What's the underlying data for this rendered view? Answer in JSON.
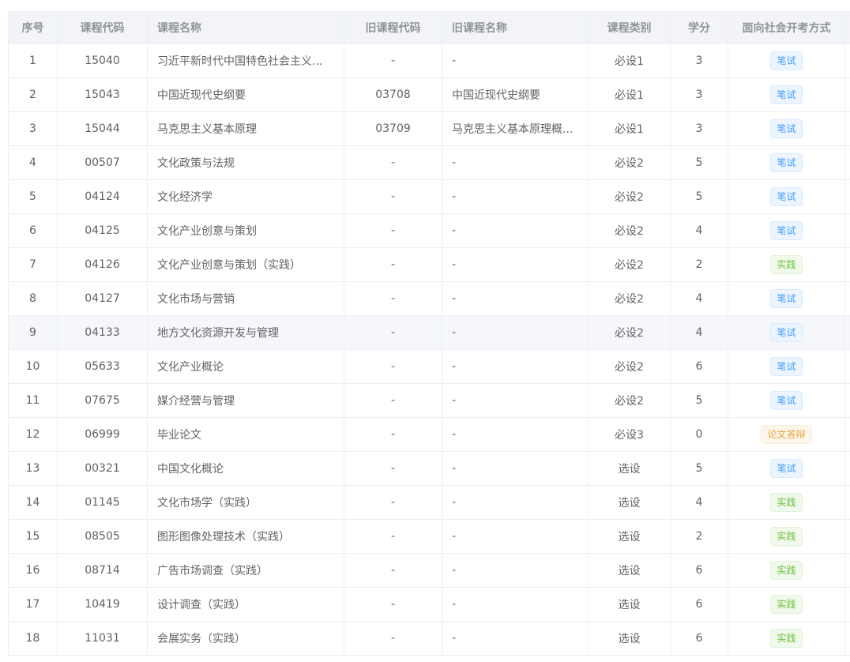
{
  "table": {
    "headers": [
      "序号",
      "课程代码",
      "课程名称",
      "旧课程代码",
      "旧课程名称",
      "课程类别",
      "学分",
      "面向社会开考方式"
    ],
    "rows": [
      {
        "no": "1",
        "code": "15040",
        "name": "习近平新时代中国特色社会主义...",
        "old_code": "-",
        "old_name": "-",
        "category": "必设1",
        "credits": "3",
        "exam": "笔试",
        "exam_type": "written"
      },
      {
        "no": "2",
        "code": "15043",
        "name": "中国近现代史纲要",
        "old_code": "03708",
        "old_name": "中国近现代史纲要",
        "category": "必设1",
        "credits": "3",
        "exam": "笔试",
        "exam_type": "written"
      },
      {
        "no": "3",
        "code": "15044",
        "name": "马克思主义基本原理",
        "old_code": "03709",
        "old_name": "马克思主义基本原理概...",
        "category": "必设1",
        "credits": "3",
        "exam": "笔试",
        "exam_type": "written"
      },
      {
        "no": "4",
        "code": "00507",
        "name": "文化政策与法规",
        "old_code": "-",
        "old_name": "-",
        "category": "必设2",
        "credits": "5",
        "exam": "笔试",
        "exam_type": "written"
      },
      {
        "no": "5",
        "code": "04124",
        "name": "文化经济学",
        "old_code": "-",
        "old_name": "-",
        "category": "必设2",
        "credits": "5",
        "exam": "笔试",
        "exam_type": "written"
      },
      {
        "no": "6",
        "code": "04125",
        "name": "文化产业创意与策划",
        "old_code": "-",
        "old_name": "-",
        "category": "必设2",
        "credits": "4",
        "exam": "笔试",
        "exam_type": "written"
      },
      {
        "no": "7",
        "code": "04126",
        "name": "文化产业创意与策划（实践）",
        "old_code": "-",
        "old_name": "-",
        "category": "必设2",
        "credits": "2",
        "exam": "实践",
        "exam_type": "practice"
      },
      {
        "no": "8",
        "code": "04127",
        "name": "文化市场与营销",
        "old_code": "-",
        "old_name": "-",
        "category": "必设2",
        "credits": "4",
        "exam": "笔试",
        "exam_type": "written"
      },
      {
        "no": "9",
        "code": "04133",
        "name": "地方文化资源开发与管理",
        "old_code": "-",
        "old_name": "-",
        "category": "必设2",
        "credits": "4",
        "exam": "笔试",
        "exam_type": "written"
      },
      {
        "no": "10",
        "code": "05633",
        "name": "文化产业概论",
        "old_code": "-",
        "old_name": "-",
        "category": "必设2",
        "credits": "6",
        "exam": "笔试",
        "exam_type": "written"
      },
      {
        "no": "11",
        "code": "07675",
        "name": "媒介经营与管理",
        "old_code": "-",
        "old_name": "-",
        "category": "必设2",
        "credits": "5",
        "exam": "笔试",
        "exam_type": "written"
      },
      {
        "no": "12",
        "code": "06999",
        "name": "毕业论文",
        "old_code": "-",
        "old_name": "-",
        "category": "必设3",
        "credits": "0",
        "exam": "论文答辩",
        "exam_type": "thesis"
      },
      {
        "no": "13",
        "code": "00321",
        "name": "中国文化概论",
        "old_code": "-",
        "old_name": "-",
        "category": "选设",
        "credits": "5",
        "exam": "笔试",
        "exam_type": "written"
      },
      {
        "no": "14",
        "code": "01145",
        "name": "文化市场学（实践）",
        "old_code": "-",
        "old_name": "-",
        "category": "选设",
        "credits": "4",
        "exam": "实践",
        "exam_type": "practice"
      },
      {
        "no": "15",
        "code": "08505",
        "name": "图形图像处理技术（实践）",
        "old_code": "-",
        "old_name": "-",
        "category": "选设",
        "credits": "2",
        "exam": "实践",
        "exam_type": "practice"
      },
      {
        "no": "16",
        "code": "08714",
        "name": "广告市场调查（实践）",
        "old_code": "-",
        "old_name": "-",
        "category": "选设",
        "credits": "6",
        "exam": "实践",
        "exam_type": "practice"
      },
      {
        "no": "17",
        "code": "10419",
        "name": "设计调查（实践）",
        "old_code": "-",
        "old_name": "-",
        "category": "选设",
        "credits": "6",
        "exam": "实践",
        "exam_type": "practice"
      },
      {
        "no": "18",
        "code": "11031",
        "name": "会展实务（实践）",
        "old_code": "-",
        "old_name": "-",
        "category": "选设",
        "credits": "6",
        "exam": "实践",
        "exam_type": "practice"
      }
    ]
  },
  "colors": {
    "header_bg": "#f2f4f7",
    "border": "#ebeef5",
    "written_tag": "#409eff",
    "practice_tag": "#67c23a",
    "thesis_tag": "#e6a23c",
    "hover_row": "#f5f7fa"
  }
}
